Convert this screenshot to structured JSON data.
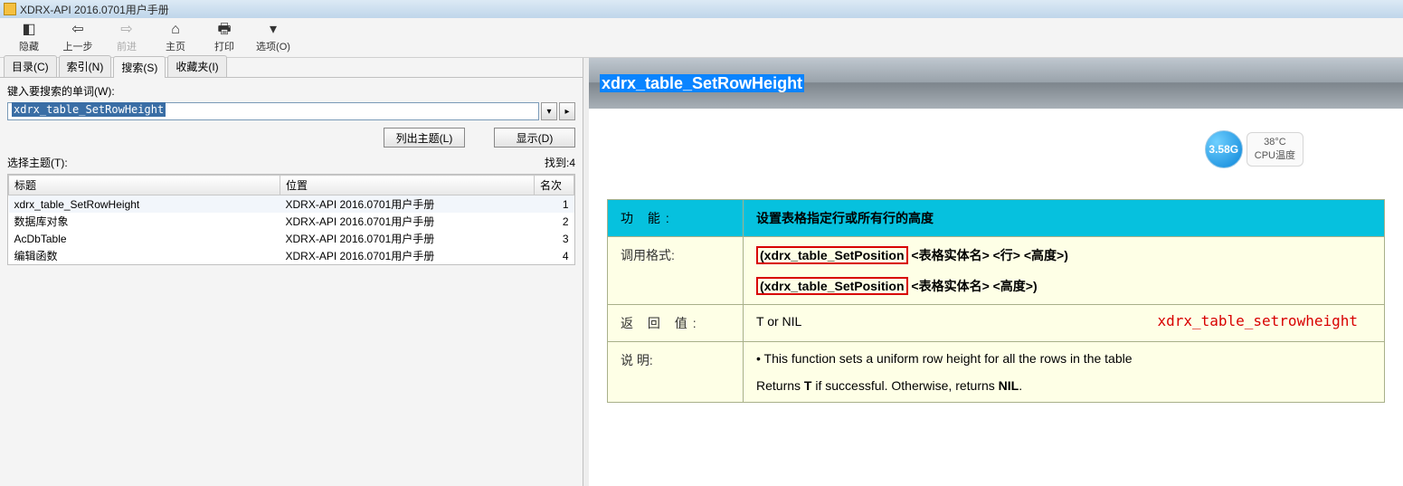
{
  "window": {
    "title": "XDRX-API 2016.0701用户手册"
  },
  "toolbar": {
    "hide": "隐藏",
    "back": "上一步",
    "forward": "前进",
    "home": "主页",
    "print": "打印",
    "options": "选项(O)"
  },
  "tabs": {
    "contents": "目录(C)",
    "index": "索引(N)",
    "search": "搜索(S)",
    "favorites": "收藏夹(I)"
  },
  "search": {
    "label": "键入要搜索的单词(W):",
    "value": "xdrx_table_SetRowHeight",
    "list_topics": "列出主题(L)",
    "display": "显示(D)",
    "select_topic": "选择主题(T):",
    "found": "找到:4",
    "cols": {
      "title": "标题",
      "location": "位置",
      "rank": "名次"
    },
    "rows": [
      {
        "title": "xdrx_table_SetRowHeight",
        "location": "XDRX-API 2016.0701用户手册",
        "rank": "1"
      },
      {
        "title": "数据库对象",
        "location": "XDRX-API 2016.0701用户手册",
        "rank": "2"
      },
      {
        "title": "AcDbTable",
        "location": "XDRX-API 2016.0701用户手册",
        "rank": "3"
      },
      {
        "title": "编辑函数",
        "location": "XDRX-API 2016.0701用户手册",
        "rank": "4"
      }
    ]
  },
  "widget": {
    "orb": "3.58G",
    "temp": "38°C",
    "label": "CPU温度"
  },
  "doc": {
    "heading": "xdrx_table_SetRowHeight",
    "func_label": "功   能:",
    "func_text": "设置表格指定行或所有行的高度",
    "call_label": "调用格式:",
    "call1_fn": "(xdrx_table_SetPosition",
    "call1_rest": " <表格实体名> <行> <高度>)",
    "call2_fn": "(xdrx_table_SetPosition",
    "call2_rest": " <表格实体名> <高度>)",
    "ret_label": "返 回 值:",
    "ret_text": "T or NIL",
    "desc_label": "说     明:",
    "desc_bullet": "• This function sets a uniform row height for all the rows in the table",
    "desc_line2a": "Returns ",
    "desc_line2b": "T",
    "desc_line2c": " if successful. Otherwise, returns ",
    "desc_line2d": "NIL",
    "desc_line2e": ".",
    "red_note": "xdrx_table_setrowheight"
  }
}
